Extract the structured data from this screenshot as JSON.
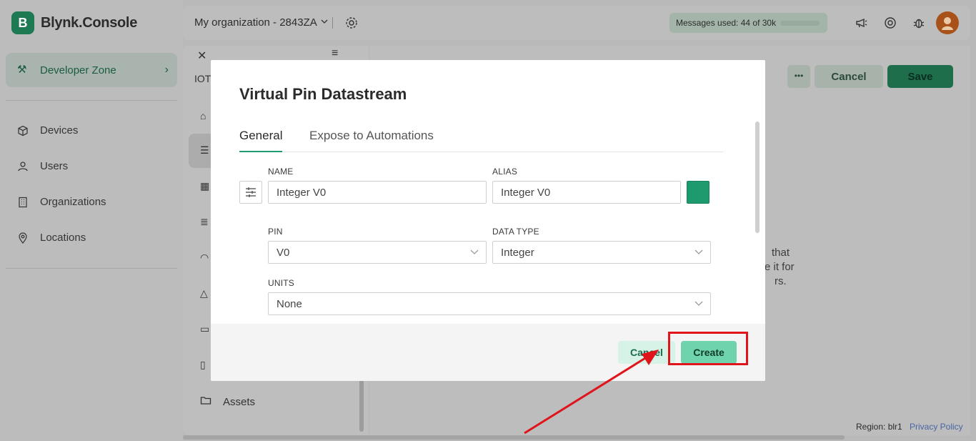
{
  "app": {
    "logo_letter": "B",
    "logo_text": "Blynk.Console"
  },
  "sidebar": {
    "dev_zone": {
      "label": "Developer Zone"
    },
    "items": [
      {
        "label": "Devices",
        "icon": "cube-icon"
      },
      {
        "label": "Users",
        "icon": "user-icon"
      },
      {
        "label": "Organizations",
        "icon": "building-icon"
      },
      {
        "label": "Locations",
        "icon": "pin-icon"
      }
    ]
  },
  "topbar": {
    "organization": "My organization - 2843ZA",
    "messages_label": "Messages used:",
    "messages_value": "44 of 30k"
  },
  "inner": {
    "title_fragment": "IOTI",
    "assets_label": "Assets"
  },
  "page": {
    "cancel_label": "Cancel",
    "save_label": "Save",
    "hint_lines": [
      "that",
      "e it for",
      "rs."
    ]
  },
  "footer": {
    "region": "Region: blr1",
    "privacy": "Privacy Policy"
  },
  "modal": {
    "title": "Virtual Pin Datastream",
    "tabs": [
      {
        "label": "General",
        "active": true
      },
      {
        "label": "Expose to Automations",
        "active": false
      }
    ],
    "fields": {
      "name": {
        "label": "NAME",
        "value": "Integer V0"
      },
      "alias": {
        "label": "ALIAS",
        "value": "Integer V0"
      },
      "pin": {
        "label": "PIN",
        "value": "V0"
      },
      "data_type": {
        "label": "DATA TYPE",
        "value": "Integer"
      },
      "units": {
        "label": "UNITS",
        "value": "None"
      }
    },
    "color": "#1e9b6e",
    "cancel_label": "Cancel",
    "create_label": "Create"
  },
  "colors": {
    "accent": "#1e9e6e",
    "annotation": "#e0141b"
  }
}
